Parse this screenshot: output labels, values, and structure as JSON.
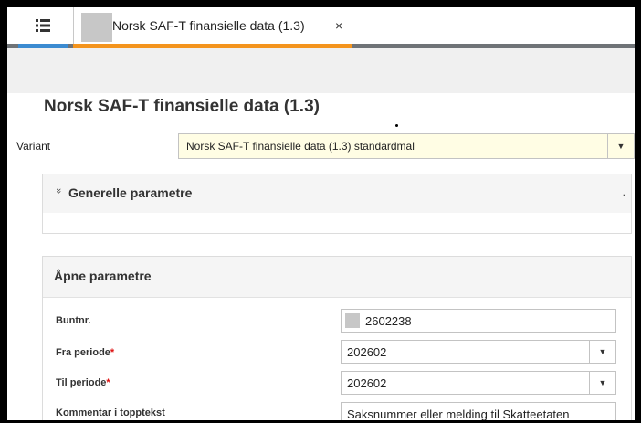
{
  "tabs": {
    "menu_icon": "list-menu-icon",
    "active_title": "Norsk SAF-T finansielle data (1.3)",
    "close_glyph": "×"
  },
  "colors": {
    "menu_tab_accent": "#3b8bd1",
    "active_tab_accent": "#f4941d",
    "tabbar_line": "#6f7377",
    "variant_background": "#fffde4",
    "required_marker": "#d11111"
  },
  "page": {
    "title": "Norsk SAF-T finansielle data (1.3)"
  },
  "variant": {
    "label": "Variant",
    "value": "Norsk SAF-T finansielle data (1.3) standardmal"
  },
  "general_parameters": {
    "chevron": "»",
    "title": "Generelle parametre",
    "trailing_mark": "."
  },
  "open_parameters": {
    "title": "Åpne parametre",
    "fields": [
      {
        "label": "Buntnr.",
        "required": "",
        "value": "2602238"
      },
      {
        "label": "Fra periode",
        "required": "*",
        "value": "202602"
      },
      {
        "label": "Til periode",
        "required": "*",
        "value": "202602"
      },
      {
        "label": "Kommentar i topptekst",
        "required": "",
        "value": "Saksnummer eller melding til Skatteetaten"
      }
    ]
  }
}
